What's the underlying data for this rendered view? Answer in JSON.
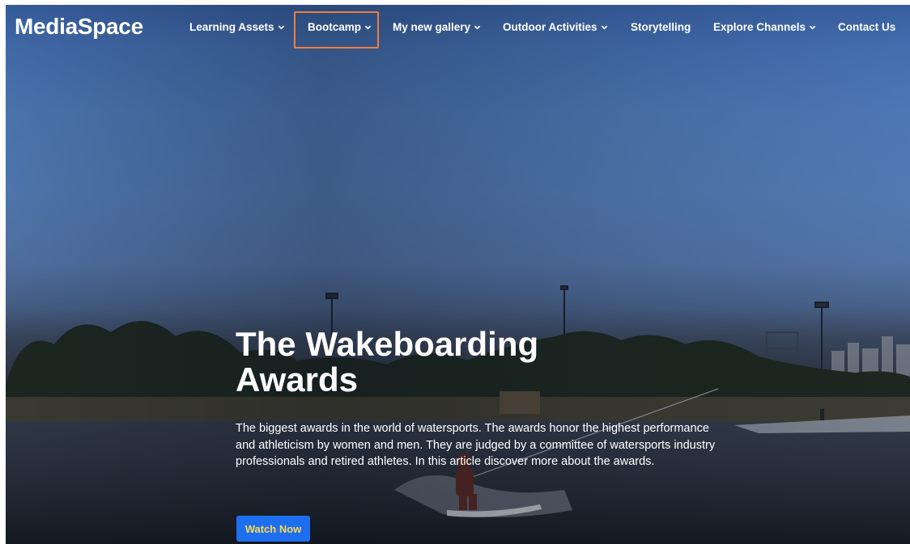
{
  "brand": {
    "logo": "MediaSpace"
  },
  "nav": {
    "items": [
      {
        "label": "Learning Assets",
        "has_dropdown": true
      },
      {
        "label": "Bootcamp",
        "has_dropdown": true,
        "highlighted": true
      },
      {
        "label": "My new gallery",
        "has_dropdown": true
      },
      {
        "label": "Outdoor Activities",
        "has_dropdown": true
      },
      {
        "label": "Storytelling",
        "has_dropdown": false
      },
      {
        "label": "Explore Channels",
        "has_dropdown": true
      },
      {
        "label": "Contact Us",
        "has_dropdown": false
      }
    ],
    "highlight_color": "#ee7f3e"
  },
  "hero": {
    "title": "The Wakeboarding Awards",
    "description": "The biggest awards in the world of watersports. The awards honor the highest performance and athleticism by women and men. They are judged by a committee of watersports industry professionals and retired athletes. In this article discover more about the awards.",
    "cta_label": "Watch Now",
    "cta_color": "#1e6ff0",
    "cta_text_color": "#ffd84a"
  }
}
